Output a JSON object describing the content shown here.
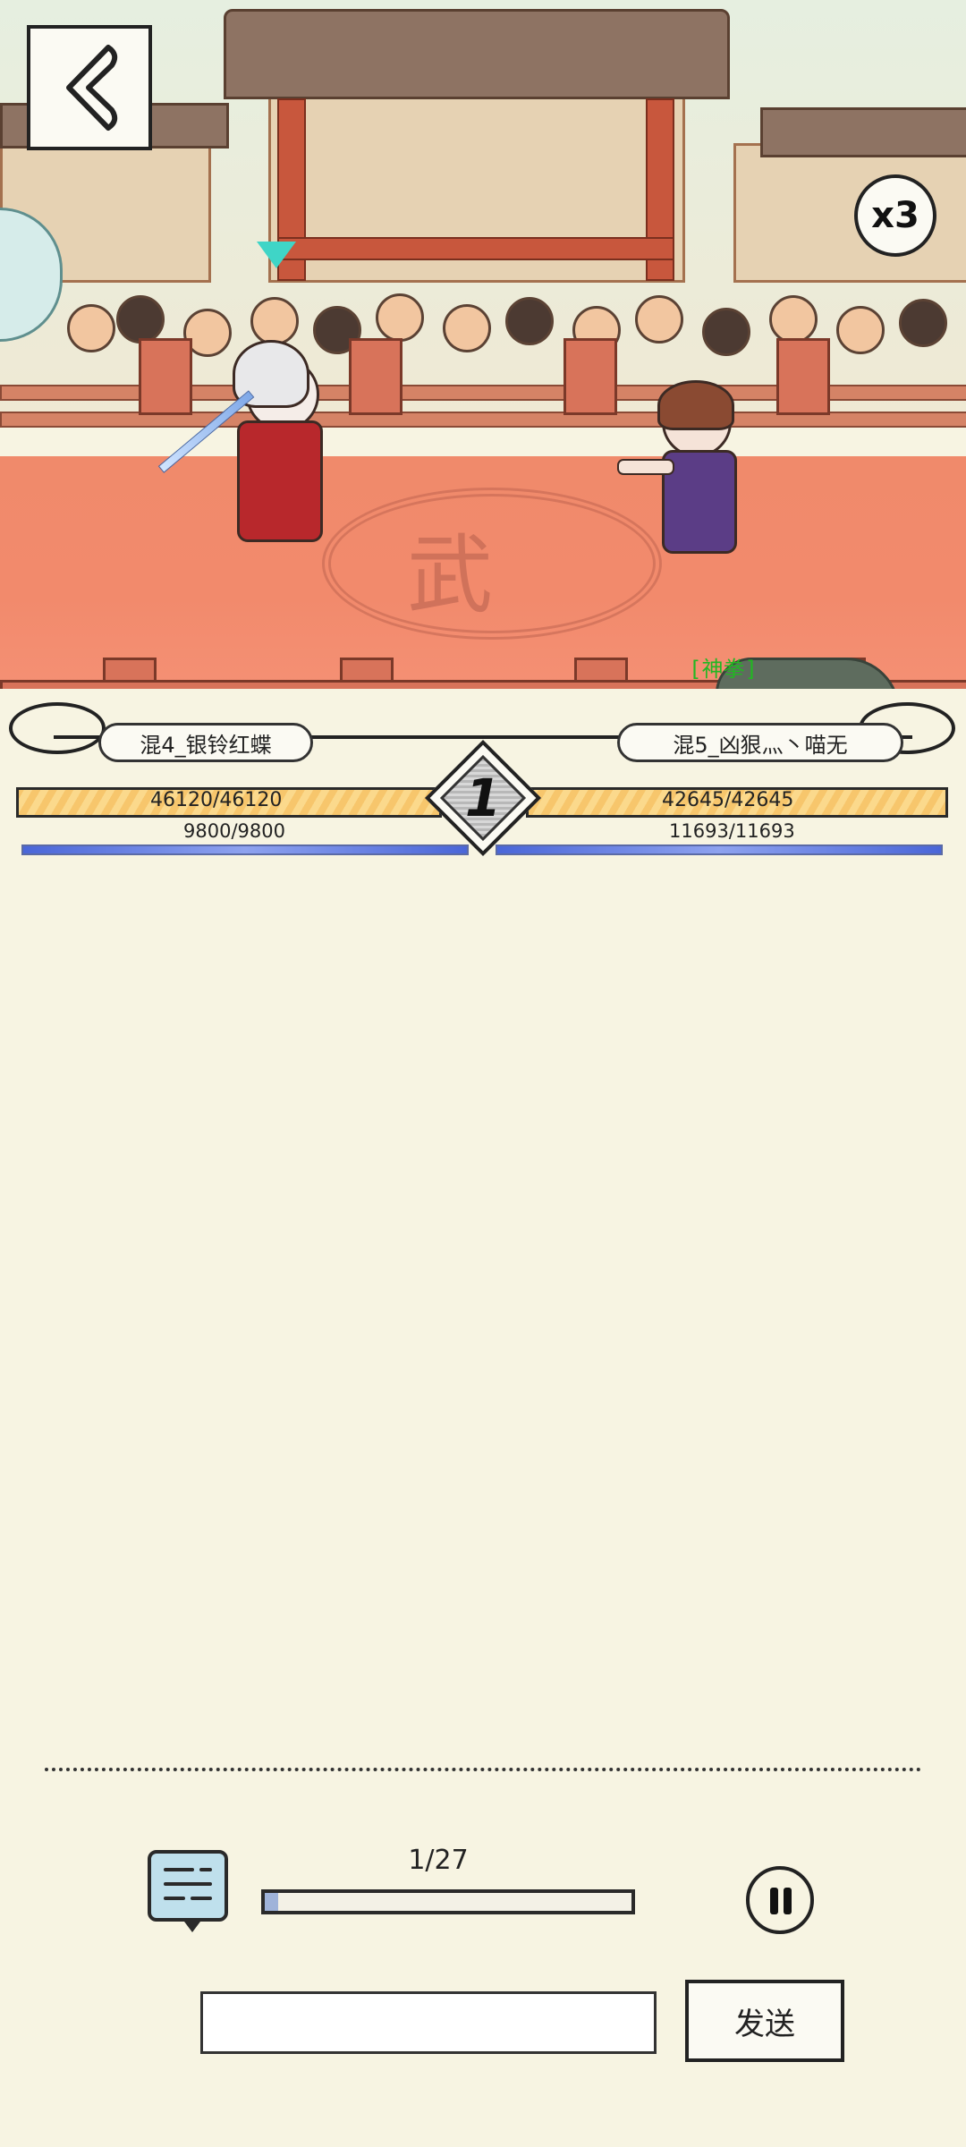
{
  "battle": {
    "speed_label": "x3",
    "round": "1",
    "special_tag": "[神拳]",
    "arena_emblem": "武"
  },
  "player_left": {
    "name": "混4_银铃红蝶",
    "hp_text": "46120/46120",
    "hp_fraction": 1.0,
    "mp_text": "9800/9800",
    "mp_fraction": 1.0
  },
  "player_right": {
    "name": "混5_凶狠灬丶喵无",
    "hp_text": "42645/42645",
    "hp_fraction": 1.0,
    "mp_text": "11693/11693",
    "mp_fraction": 1.0
  },
  "controls": {
    "progress_text": "1/27",
    "progress_fraction": 0.037,
    "message_placeholder": "",
    "send_label": "发送"
  },
  "colors": {
    "background": "#f7f4e2",
    "hp_bar": "#f7c66c",
    "mp_bar": "#4a66d8",
    "arena_floor": "#f08a6b",
    "indicator": "#3fd5c7",
    "special_tag": "#22b722"
  },
  "icons": {
    "back": "back-arrow-icon",
    "chat": "chat-bubble-icon",
    "pause": "pause-icon",
    "turn_indicator": "triangle-down-icon"
  }
}
